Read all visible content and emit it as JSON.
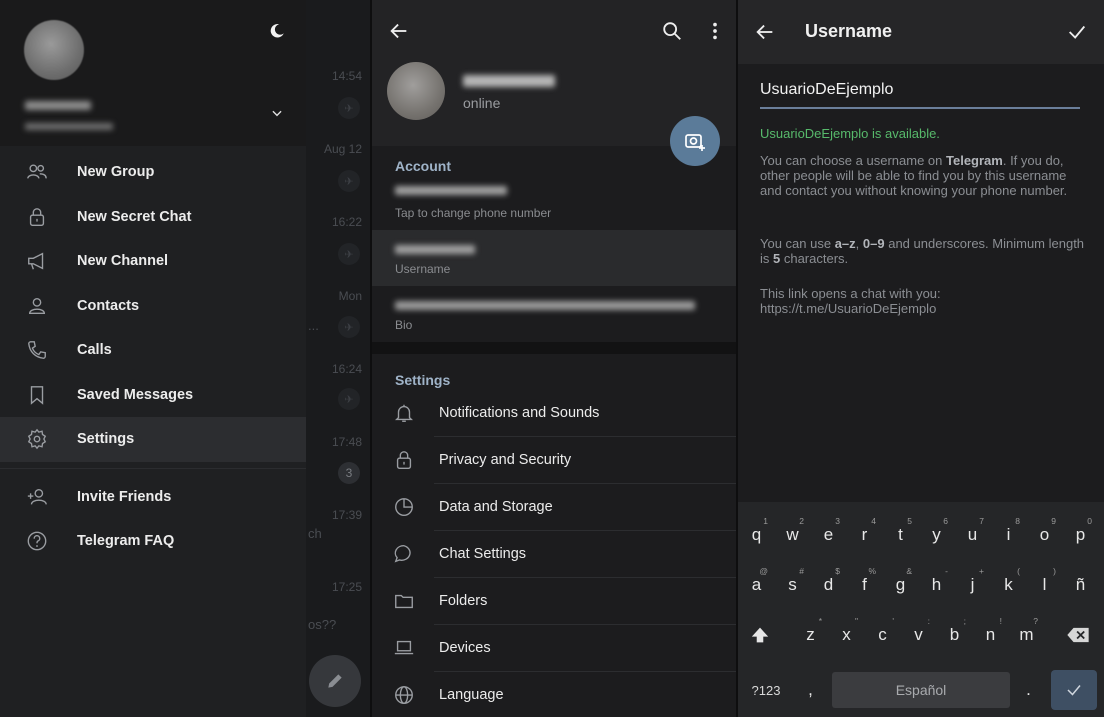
{
  "drawer": {
    "items": [
      {
        "label": "New Group",
        "icon": "group-icon"
      },
      {
        "label": "New Secret Chat",
        "icon": "lock-icon"
      },
      {
        "label": "New Channel",
        "icon": "megaphone-icon"
      },
      {
        "label": "Contacts",
        "icon": "person-icon"
      },
      {
        "label": "Calls",
        "icon": "phone-icon"
      },
      {
        "label": "Saved Messages",
        "icon": "bookmark-icon"
      },
      {
        "label": "Settings",
        "icon": "gear-icon"
      }
    ],
    "extra_items": [
      {
        "label": "Invite Friends",
        "icon": "add-person-icon"
      },
      {
        "label": "Telegram FAQ",
        "icon": "help-circle-icon"
      }
    ]
  },
  "chat_list_bg": {
    "times": [
      "14:54",
      "Aug 12",
      "16:22",
      "Mon",
      "16:24",
      "17:48",
      "17:39",
      "17:25"
    ],
    "unread_count": "3",
    "fragments": [
      "...",
      "ch",
      "os??"
    ]
  },
  "profile": {
    "status": "online",
    "account_section_title": "Account",
    "phone_hint": "Tap to change phone number",
    "username_label": "Username",
    "bio_label": "Bio",
    "settings_section_title": "Settings",
    "settings_items": [
      {
        "label": "Notifications and Sounds",
        "icon": "bell-icon"
      },
      {
        "label": "Privacy and Security",
        "icon": "lock-icon"
      },
      {
        "label": "Data and Storage",
        "icon": "pie-chart-icon"
      },
      {
        "label": "Chat Settings",
        "icon": "chat-bubble-icon"
      },
      {
        "label": "Folders",
        "icon": "folder-icon"
      },
      {
        "label": "Devices",
        "icon": "laptop-icon"
      },
      {
        "label": "Language",
        "icon": "globe-icon"
      }
    ]
  },
  "username_screen": {
    "title": "Username",
    "input_value": "UsuarioDeEjemplo",
    "availability": "UsuarioDeEjemplo is available.",
    "help1_pre": "You can choose a username on ",
    "help1_bold": "Telegram",
    "help1_post": ". If you do, other people will be able to find you by this username and contact you without knowing your phone number.",
    "help2_pre": "You can use ",
    "help2_b1": "a–z",
    "help2_mid1": ", ",
    "help2_b2": "0–9",
    "help2_mid2": " and underscores. Minimum length is ",
    "help2_b3": "5",
    "help2_post": " characters.",
    "link_intro": "This link opens a chat with you:",
    "link": "https://t.me/UsuarioDeEjemplo"
  },
  "keyboard": {
    "row1": [
      "q",
      "w",
      "e",
      "r",
      "t",
      "y",
      "u",
      "i",
      "o",
      "p"
    ],
    "row1_hints": [
      "1",
      "2",
      "3",
      "4",
      "5",
      "6",
      "7",
      "8",
      "9",
      "0"
    ],
    "row2": [
      "a",
      "s",
      "d",
      "f",
      "g",
      "h",
      "j",
      "k",
      "l",
      "ñ"
    ],
    "row2_hints": [
      "@",
      "#",
      "$",
      "%",
      "&",
      "-",
      "+",
      "(",
      ")",
      ""
    ],
    "row3": [
      "z",
      "x",
      "c",
      "v",
      "b",
      "n",
      "m"
    ],
    "row3_hints": [
      "*",
      "\"",
      "'",
      ":",
      ";",
      "!",
      "?"
    ],
    "num_toggle": "?123",
    "comma": ",",
    "space_label": "Español",
    "period": "."
  }
}
